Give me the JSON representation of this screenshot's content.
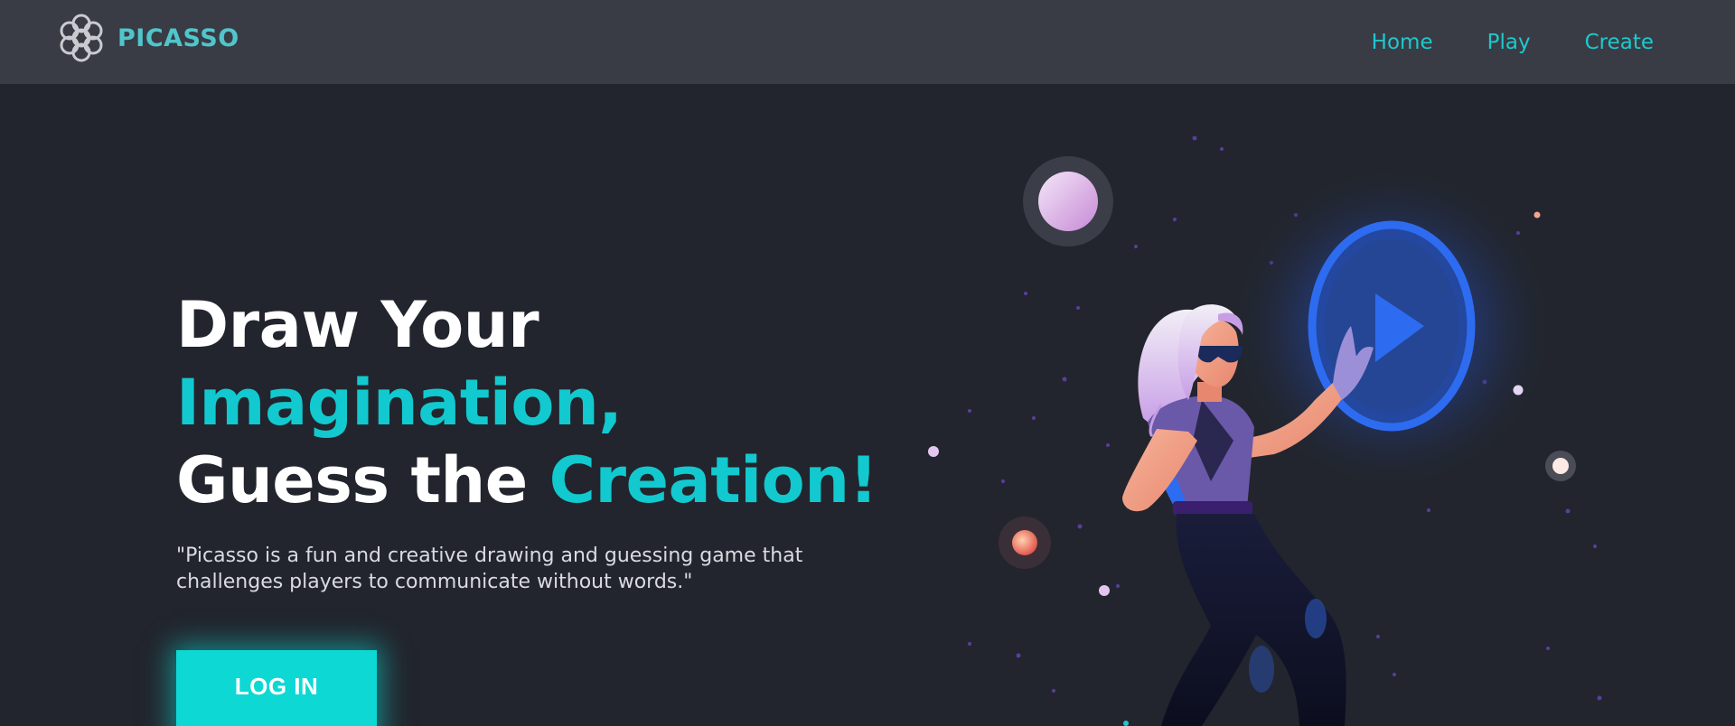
{
  "brand": {
    "name": "PICASSO",
    "logo_icon": "flower-logo-icon"
  },
  "nav": {
    "items": [
      {
        "label": "Home"
      },
      {
        "label": "Play"
      },
      {
        "label": "Create"
      }
    ]
  },
  "hero": {
    "headline": {
      "line1": "Draw Your",
      "line2": "Imagination,",
      "line3_plain": "Guess the ",
      "line3_accent": "Creation!"
    },
    "tagline": "\"Picasso is a fun and creative drawing and guessing game that challenges players to communicate without words.\"",
    "login_label": "LOG IN",
    "illustration_icon": "woman-touching-play-button-illustration"
  },
  "colors": {
    "navbar_bg": "#393c45",
    "page_bg": "#22252d",
    "accent": "#12c9cf",
    "button_bg": "#0ed8d4",
    "play_blue": "#2d6cf0"
  }
}
